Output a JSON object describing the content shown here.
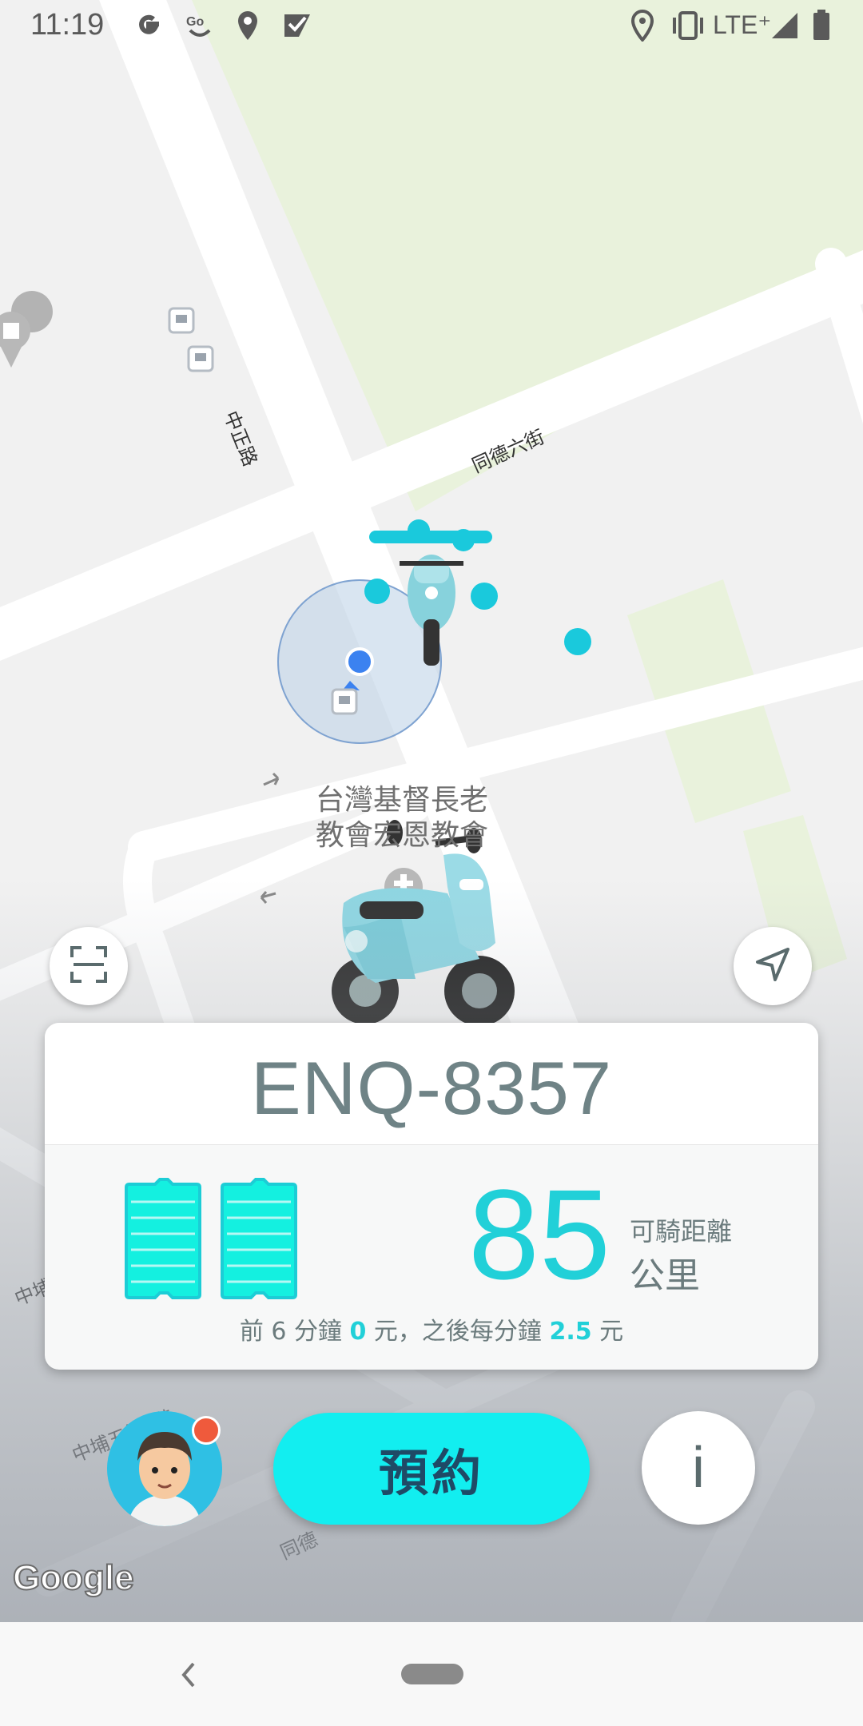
{
  "status_bar": {
    "time": "11:19",
    "network": "LTE⁺",
    "left_icons": [
      "google-g-icon",
      "gogoro-go-icon",
      "location-pin-icon",
      "tasks-check-icon"
    ],
    "right_icons": [
      "location-pin-icon",
      "vibrate-icon",
      "signal-icon",
      "battery-icon"
    ]
  },
  "map": {
    "streets": {
      "zhongzheng": "中正路",
      "tongde6": "同德六街",
      "zhongpu5_1": "中埔五街1巷",
      "zhongpu_partial": "中埔",
      "tongde_partial": "同德"
    },
    "poi": {
      "line1": "台灣基督長老",
      "line2": "教會宏恩教會"
    },
    "attribution": "Google",
    "colors": {
      "park": "#eaf3dc",
      "road": "#ffffff",
      "scooter_dot": "#1ac9dc",
      "user_dot": "#3b82f0"
    }
  },
  "scooter_card": {
    "plate": "ENQ-8357",
    "battery_count": 2,
    "battery_level": 1.0,
    "range_value": "85",
    "range_label": "可騎距離",
    "range_unit": "公里",
    "fare": {
      "part1": "前 6 分鐘 ",
      "free_value": "0",
      "part2": " 元，之後每分鐘 ",
      "rate_value": "2.5",
      "part3": " 元"
    },
    "accent_color": "#21d0d8"
  },
  "actions": {
    "reserve_label": "預約",
    "info_label": "i",
    "scan_icon": "scan-frame-icon",
    "locate_icon": "navigation-arrow-icon",
    "avatar_icon": "user-avatar",
    "notification_dot_color": "#ef5a3c"
  },
  "nav_bar": {
    "back_icon": "back-chevron-icon",
    "home_icon": "home-pill-icon"
  }
}
